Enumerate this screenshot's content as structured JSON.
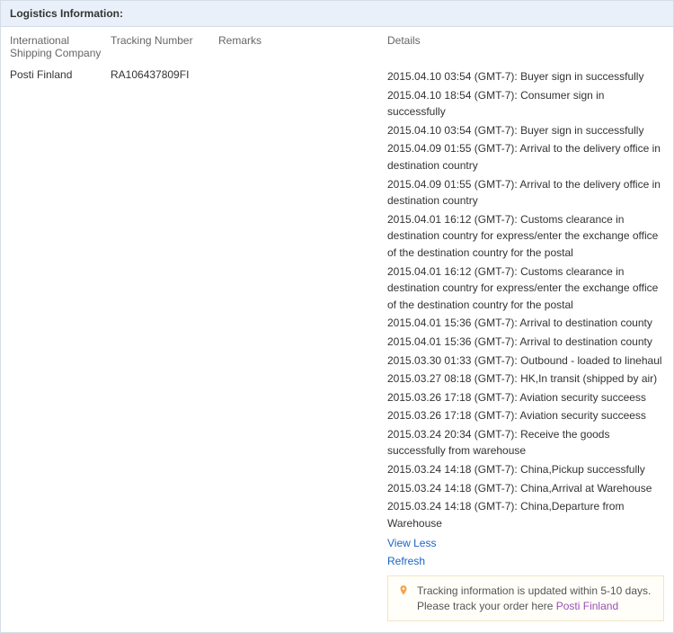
{
  "panel": {
    "title": "Logistics Information:"
  },
  "headers": {
    "company": "International Shipping Company",
    "tracking": "Tracking Number",
    "remarks": "Remarks",
    "details": "Details"
  },
  "row": {
    "company": "Posti Finland",
    "tracking": "RA106437809FI",
    "remarks": ""
  },
  "events": [
    "2015.04.10 03:54 (GMT-7): Buyer sign in successfully",
    "2015.04.10 18:54 (GMT-7): Consumer sign in successfully",
    "2015.04.10 03:54 (GMT-7): Buyer sign in successfully",
    "2015.04.09 01:55 (GMT-7): Arrival to the delivery office in destination country",
    "2015.04.09 01:55 (GMT-7): Arrival to the delivery office in destination country",
    "2015.04.01 16:12 (GMT-7): Customs clearance in destination country for express/enter the exchange office of the destination country for the postal",
    "2015.04.01 16:12 (GMT-7): Customs clearance in destination country for express/enter the exchange office of the destination country for the postal",
    "2015.04.01 15:36 (GMT-7): Arrival to destination county",
    "2015.04.01 15:36 (GMT-7): Arrival to destination county",
    "2015.03.30 01:33 (GMT-7): Outbound - loaded to linehaul",
    "2015.03.27 08:18 (GMT-7): HK,In transit (shipped by air)",
    "2015.03.26 17:18 (GMT-7): Aviation security succeess",
    "2015.03.26 17:18 (GMT-7): Aviation security succeess",
    "2015.03.24 20:34 (GMT-7): Receive the goods successfully from warehouse",
    "2015.03.24 14:18 (GMT-7): China,Pickup successfully",
    "2015.03.24 14:18 (GMT-7): China,Arrival at Warehouse",
    "2015.03.24 14:18 (GMT-7): China,Departure from Warehouse"
  ],
  "actions": {
    "view_less": "View Less",
    "refresh": "Refresh"
  },
  "notice": {
    "text_a": "Tracking information is updated within 5-10 days. Please track your order here ",
    "carrier": "Posti Finland"
  }
}
